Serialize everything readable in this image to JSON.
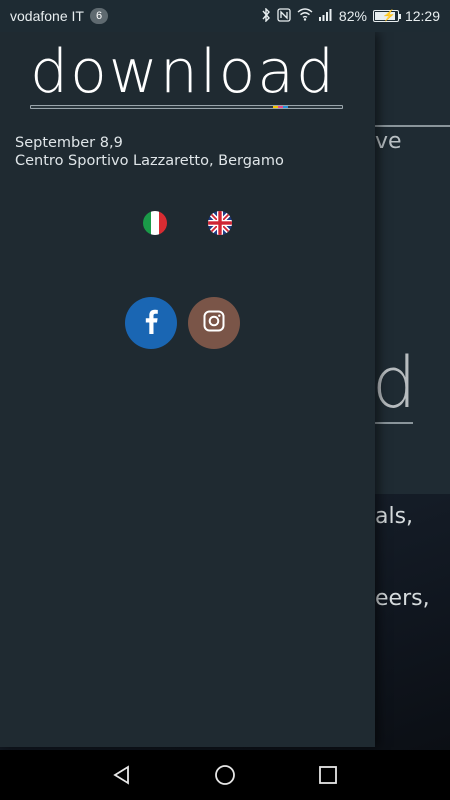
{
  "status_bar": {
    "carrier": "vodafone IT",
    "sim_badge": "6",
    "battery": "82%",
    "time": "12:29",
    "icons": [
      "bluetooth-icon",
      "nfc-icon",
      "wifi-icon",
      "signal-icon",
      "battery-charging-icon"
    ]
  },
  "drawer": {
    "logo": "download",
    "event_date": "September 8,9",
    "event_venue": "Centro Sportivo Lazzaretto, Bergamo",
    "languages": [
      {
        "name": "italian-flag-icon",
        "lang": "IT"
      },
      {
        "name": "uk-flag-icon",
        "lang": "EN"
      }
    ],
    "social": [
      {
        "name": "facebook-icon",
        "color": "#1a66b3"
      },
      {
        "name": "instagram-icon",
        "color": "#7a5548"
      }
    ]
  },
  "background_page": {
    "fragments": [
      "ve",
      "d",
      "als,",
      "eers,"
    ]
  },
  "nav_bar": {
    "buttons": [
      "back-icon",
      "home-icon",
      "recents-icon"
    ]
  },
  "colors": {
    "drawer_bg": "#1f2a31",
    "status_bg": "#1e2b33",
    "facebook": "#1a66b3",
    "instagram": "#7a5548"
  }
}
